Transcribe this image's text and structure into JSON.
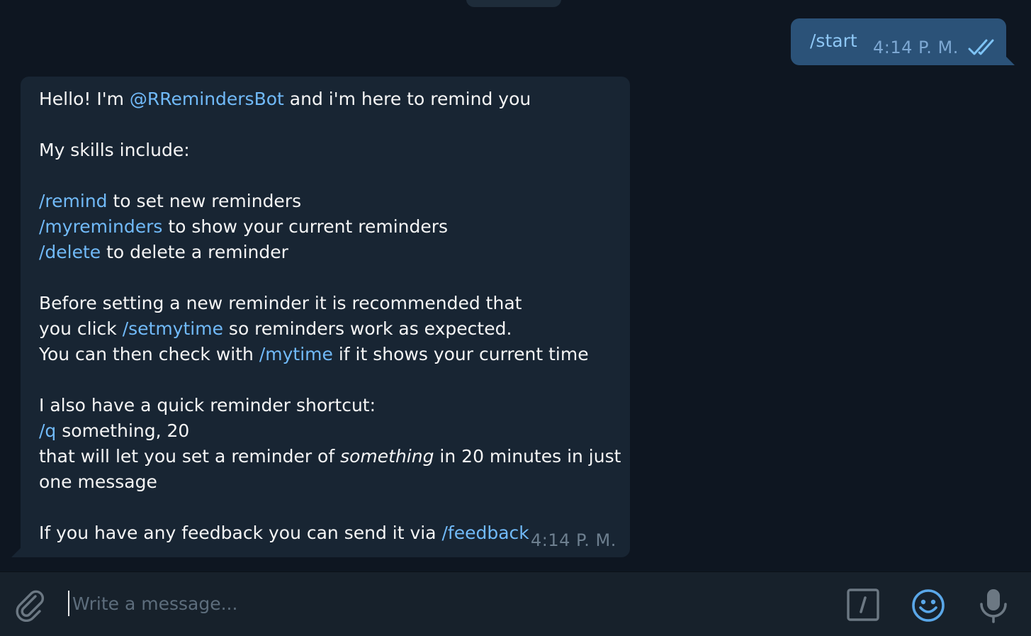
{
  "colors": {
    "background": "#0e1621",
    "outgoing_bubble": "#2b5278",
    "incoming_bubble": "#182533",
    "link": "#71baf9",
    "input_bar": "#17212b"
  },
  "outgoing_message": {
    "text": "/start",
    "time": "4:14 P. M.",
    "status_icon": "double-check-icon"
  },
  "incoming_message": {
    "greeting_prefix": "Hello! I'm ",
    "bot_handle": "@RRemindersBot",
    "greeting_suffix": " and i'm here to remind you",
    "skills_intro": "My skills include:",
    "cmd_remind": "/remind",
    "cmd_remind_desc": " to set new reminders",
    "cmd_myreminders": "/myreminders",
    "cmd_myreminders_desc": " to show your current reminders",
    "cmd_delete": "/delete",
    "cmd_delete_desc": " to delete a reminder",
    "before_line": "Before setting a new reminder it is recommended that",
    "click_prefix": "you click ",
    "cmd_setmytime": "/setmytime",
    "click_suffix": " so reminders work as expected.",
    "check_prefix": "You can then check with ",
    "cmd_mytime": "/mytime",
    "check_suffix": " if it shows your current time",
    "shortcut_intro": "I also have a quick reminder shortcut:",
    "cmd_q": "/q",
    "q_example": " something, 20",
    "that_prefix": "that will let you set a reminder of ",
    "that_italic": "something",
    "that_suffix": " in 20 minutes in just",
    "one_message": "one message",
    "feedback_prefix": "If you have any feedback you can send it via ",
    "cmd_feedback": "/feedback",
    "time": "4:14 P. M."
  },
  "composer": {
    "placeholder": "Write a message...",
    "value": "",
    "attach_icon": "paperclip-icon",
    "commands_icon": "slash-command-icon",
    "emoji_icon": "smile-icon",
    "mic_icon": "microphone-icon"
  }
}
